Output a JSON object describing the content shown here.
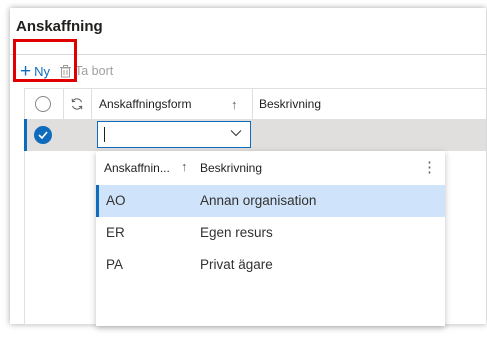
{
  "page": {
    "title": "Anskaffning"
  },
  "toolbar": {
    "new_label": "Ny",
    "delete_label": "Ta bort"
  },
  "grid": {
    "columns": [
      {
        "label": "Anskaffningsform",
        "sort": "↑"
      },
      {
        "label": "Beskrivning"
      }
    ],
    "selected_row": {
      "value": ""
    }
  },
  "dropdown": {
    "columns": [
      {
        "label": "Anskaffnin...",
        "sort": "↑"
      },
      {
        "label": "Beskrivning"
      }
    ],
    "more": "⋮",
    "rows": [
      {
        "code": "AO",
        "description": "Annan organisation",
        "selected": true
      },
      {
        "code": "ER",
        "description": "Egen resurs",
        "selected": false
      },
      {
        "code": "PA",
        "description": "Privat ägare",
        "selected": false
      }
    ]
  },
  "colors": {
    "accent": "#0f6cbd",
    "highlight": "#e00000",
    "selected_row": "#cfe4fa"
  }
}
